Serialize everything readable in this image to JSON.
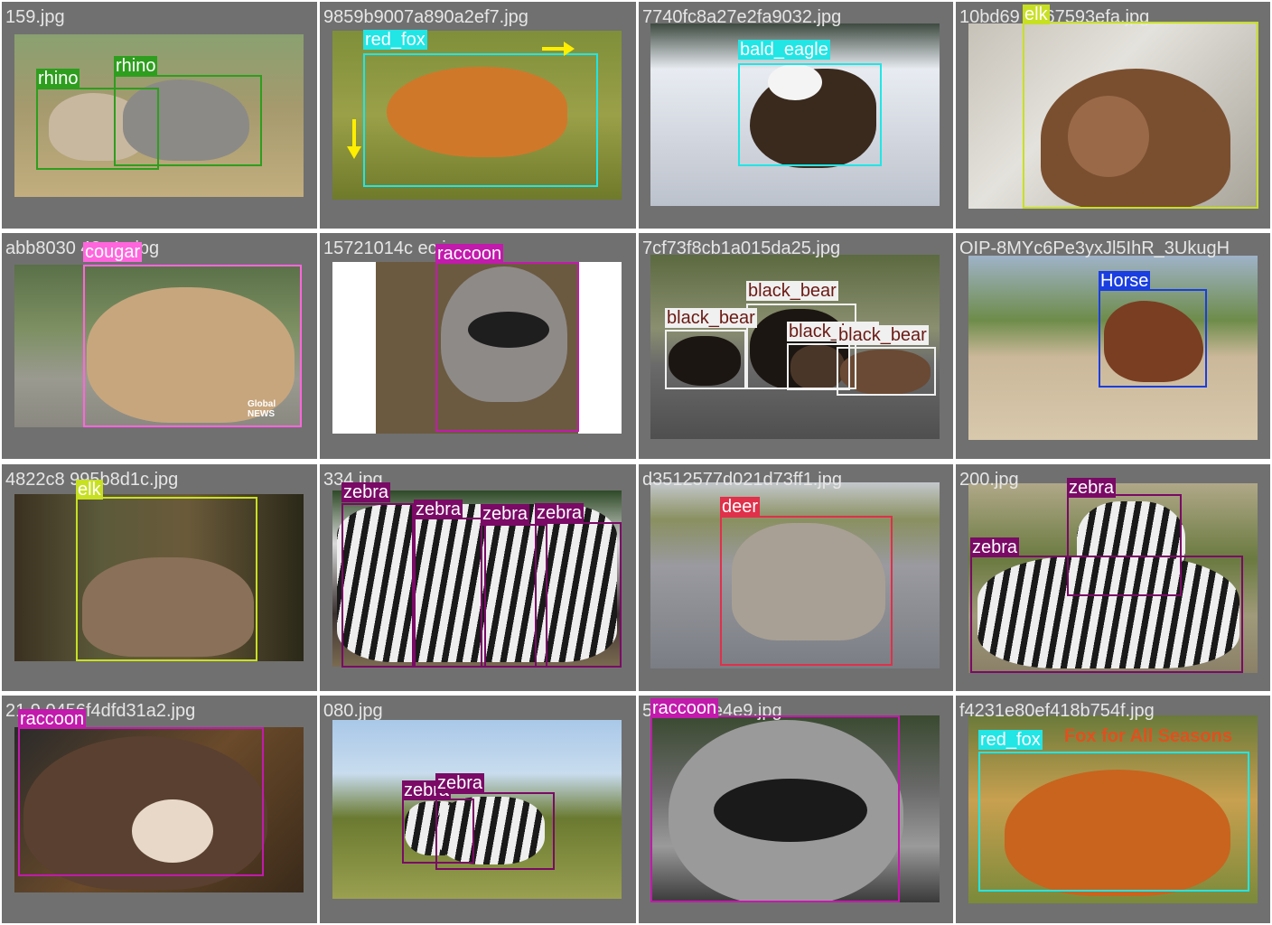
{
  "cells": [
    {
      "filename": "159.jpg",
      "boxes": [
        {
          "label": "rhino",
          "color": "#2e9e1e",
          "text": "#ffffff"
        },
        {
          "label": "rhino",
          "color": "#2e9e1e",
          "text": "#ffffff"
        }
      ]
    },
    {
      "filename": "9859b9007a890a2ef7.jpg",
      "boxes": [
        {
          "label": "red_fox",
          "color": "#22e5e5",
          "text": "#ffffff"
        }
      ]
    },
    {
      "filename": "7740fc8a27e2fa9032.jpg",
      "boxes": [
        {
          "label": "bald_eagle",
          "color": "#22e5e5",
          "text": "#ffffff"
        }
      ]
    },
    {
      "filename": "10bd69 6667593efa.jpg",
      "boxes": [
        {
          "label": "elk",
          "color": "#c8e022",
          "text": "#ffffff"
        }
      ]
    },
    {
      "filename": "abb8030 43c4e.jpg",
      "boxes": [
        {
          "label": "cougar",
          "color": "#ff66dd",
          "text": "#ffffff"
        }
      ]
    },
    {
      "filename": "15721014c ec.jpg",
      "boxes": [
        {
          "label": "raccoon",
          "color": "#c21aac",
          "text": "#ffffff"
        }
      ]
    },
    {
      "filename": "7cf73f8cb1a015da25.jpg",
      "boxes": [
        {
          "label": "black_bear",
          "color": "#f0f0f0",
          "text": "#6b1a14"
        },
        {
          "label": "black_bear",
          "color": "#f0f0f0",
          "text": "#6b1a14"
        },
        {
          "label": "black_bear",
          "color": "#f0f0f0",
          "text": "#6b1a14"
        },
        {
          "label": "black_bear",
          "color": "#f0f0f0",
          "text": "#6b1a14"
        }
      ]
    },
    {
      "filename": "OIP-8MYc6Pe3yxJl5IhR_3UkugH",
      "boxes": [
        {
          "label": "Horse",
          "color": "#1a3ee0",
          "text": "#ffffff"
        }
      ]
    },
    {
      "filename": "4822c8 995b8d1c.jpg",
      "boxes": [
        {
          "label": "elk",
          "color": "#c8e022",
          "text": "#ffffff"
        }
      ]
    },
    {
      "filename": "334.jpg",
      "boxes": [
        {
          "label": "zebra",
          "color": "#7a0a66",
          "text": "#ffffff"
        },
        {
          "label": "zebra",
          "color": "#7a0a66",
          "text": "#ffffff"
        },
        {
          "label": "zebra",
          "color": "#7a0a66",
          "text": "#ffffff"
        },
        {
          "label": "zebra",
          "color": "#7a0a66",
          "text": "#ffffff"
        }
      ]
    },
    {
      "filename": "d3512577d021d73ff1.jpg",
      "boxes": [
        {
          "label": "deer",
          "color": "#e0304a",
          "text": "#ffffff"
        }
      ]
    },
    {
      "filename": "200.jpg",
      "boxes": [
        {
          "label": "zebra",
          "color": "#7a0a66",
          "text": "#ffffff"
        },
        {
          "label": "zebra",
          "color": "#7a0a66",
          "text": "#ffffff"
        }
      ]
    },
    {
      "filename": "21 9 0456f4dfd31a2.jpg",
      "boxes": [
        {
          "label": "raccoon",
          "color": "#c21aac",
          "text": "#ffffff"
        }
      ]
    },
    {
      "filename": "080.jpg",
      "boxes": [
        {
          "label": "zebra",
          "color": "#7a0a66",
          "text": "#ffffff"
        },
        {
          "label": "zebra",
          "color": "#7a0a66",
          "text": "#ffffff"
        }
      ]
    },
    {
      "filename": "5 4f04ebe4e9.jpg",
      "boxes": [
        {
          "label": "raccoon",
          "color": "#c21aac",
          "text": "#ffffff"
        }
      ]
    },
    {
      "filename": "f4231e80ef418b754f.jpg",
      "boxes": [
        {
          "label": "red_fox",
          "color": "#22e5e5",
          "text": "#ffffff"
        }
      ]
    }
  ],
  "headline_text": "Fox for All Seasons",
  "watermark_text": "Global NEWS"
}
